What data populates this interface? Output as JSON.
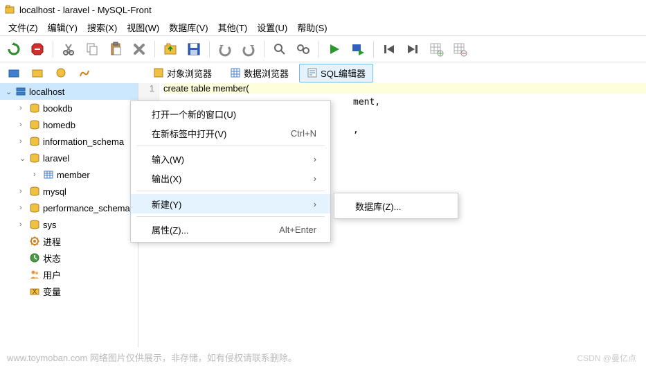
{
  "window": {
    "title": "localhost - laravel - MySQL-Front"
  },
  "menubar": {
    "items": [
      {
        "label": "文件(Z)"
      },
      {
        "label": "编辑(Y)"
      },
      {
        "label": "搜索(X)"
      },
      {
        "label": "视图(W)"
      },
      {
        "label": "数据库(V)"
      },
      {
        "label": "其他(T)"
      },
      {
        "label": "设置(U)"
      },
      {
        "label": "帮助(S)"
      }
    ]
  },
  "view_tabs": {
    "items": [
      {
        "label": "对象浏览器",
        "active": false
      },
      {
        "label": "数据浏览器",
        "active": false
      },
      {
        "label": "SQL编辑器",
        "active": true
      }
    ]
  },
  "tree": {
    "items": [
      {
        "label": "localhost",
        "icon": "server",
        "depth": 0,
        "expander": "v",
        "selected": true
      },
      {
        "label": "bookdb",
        "icon": "database",
        "depth": 1,
        "expander": ">"
      },
      {
        "label": "homedb",
        "icon": "database",
        "depth": 1,
        "expander": ">"
      },
      {
        "label": "information_schema",
        "icon": "database",
        "depth": 1,
        "expander": ">"
      },
      {
        "label": "laravel",
        "icon": "database",
        "depth": 1,
        "expander": "v"
      },
      {
        "label": "member",
        "icon": "table",
        "depth": 2,
        "expander": ">"
      },
      {
        "label": "mysql",
        "icon": "database",
        "depth": 1,
        "expander": ">"
      },
      {
        "label": "performance_schema",
        "icon": "database",
        "depth": 1,
        "expander": ">"
      },
      {
        "label": "sys",
        "icon": "database",
        "depth": 1,
        "expander": ">"
      },
      {
        "label": "进程",
        "icon": "process",
        "depth": 1,
        "expander": ""
      },
      {
        "label": "状态",
        "icon": "status",
        "depth": 1,
        "expander": ""
      },
      {
        "label": "用户",
        "icon": "users",
        "depth": 1,
        "expander": ""
      },
      {
        "label": "变量",
        "icon": "vars",
        "depth": 1,
        "expander": ""
      }
    ]
  },
  "editor": {
    "line_number": "1",
    "code_visible_1": "create table member(",
    "code_visible_2": "ment,",
    "code_visible_3": ","
  },
  "context_menu": {
    "items": [
      {
        "label": "打开一个新的窗口(U)",
        "shortcut": "",
        "arrow": false
      },
      {
        "label": "在新标签中打开(V)",
        "shortcut": "Ctrl+N",
        "arrow": false
      },
      {
        "sep": true
      },
      {
        "label": "输入(W)",
        "shortcut": "",
        "arrow": true
      },
      {
        "label": "输出(X)",
        "shortcut": "",
        "arrow": true
      },
      {
        "sep": true
      },
      {
        "label": "新建(Y)",
        "shortcut": "",
        "arrow": true,
        "highlighted": true
      },
      {
        "sep": true
      },
      {
        "label": "属性(Z)...",
        "shortcut": "Alt+Enter",
        "arrow": false
      }
    ]
  },
  "submenu": {
    "items": [
      {
        "label": "数据库(Z)..."
      }
    ]
  },
  "footer": {
    "text": "www.toymoban.com 网络图片仅供展示，非存储，如有侵权请联系删除。",
    "watermark": "CSDN @曼亿点"
  }
}
